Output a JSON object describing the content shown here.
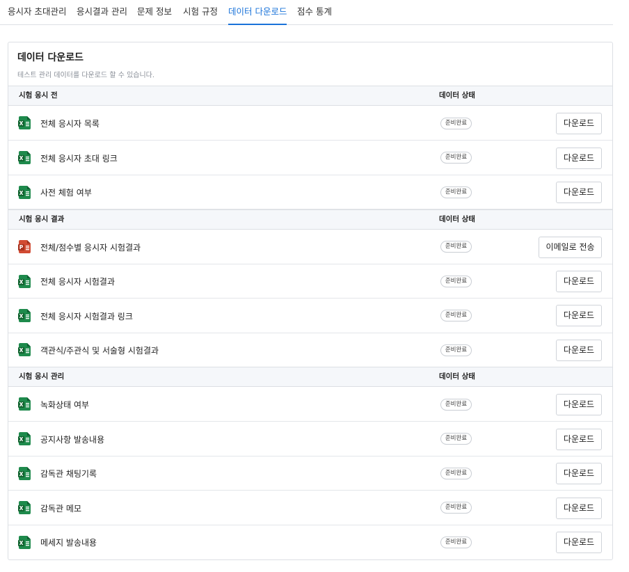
{
  "tabs": [
    {
      "label": "응시자 초대관리",
      "active": false
    },
    {
      "label": "응시결과 관리",
      "active": false
    },
    {
      "label": "문제 정보",
      "active": false
    },
    {
      "label": "시험 규정",
      "active": false
    },
    {
      "label": "데이터 다운로드",
      "active": true
    },
    {
      "label": "점수 통계",
      "active": false
    }
  ],
  "panel": {
    "title": "데이터 다운로드",
    "subtitle": "테스트 관리 데이터를 다운로드 할 수 있습니다."
  },
  "sections": [
    {
      "label": "시험 응시 전",
      "status_header": "데이터 상태",
      "rows": [
        {
          "icon": "excel-file-icon",
          "label": "전체 응시자 목록",
          "status": "준비완료",
          "action": "다운로드"
        },
        {
          "icon": "excel-file-icon",
          "label": "전체 응시자 초대 링크",
          "status": "준비완료",
          "action": "다운로드"
        },
        {
          "icon": "excel-file-icon",
          "label": "사전 체험 여부",
          "status": "준비완료",
          "action": "다운로드"
        }
      ]
    },
    {
      "label": "시험 응시 결과",
      "status_header": "데이터 상태",
      "rows": [
        {
          "icon": "powerpoint-file-icon",
          "label": "전체/점수별 응시자 시험결과",
          "status": "준비완료",
          "action": "이메일로 전송"
        },
        {
          "icon": "excel-file-icon",
          "label": "전체 응시자 시험결과",
          "status": "준비완료",
          "action": "다운로드"
        },
        {
          "icon": "excel-file-icon",
          "label": "전체 응시자 시험결과 링크",
          "status": "준비완료",
          "action": "다운로드"
        },
        {
          "icon": "excel-file-icon",
          "label": "객관식/주관식 및 서술형 시험결과",
          "status": "준비완료",
          "action": "다운로드"
        }
      ]
    },
    {
      "label": "시험 응시 관리",
      "status_header": "데이터 상태",
      "rows": [
        {
          "icon": "excel-file-icon",
          "label": "녹화상태 여부",
          "status": "준비완료",
          "action": "다운로드"
        },
        {
          "icon": "excel-file-icon",
          "label": "공지사항 발송내용",
          "status": "준비완료",
          "action": "다운로드"
        },
        {
          "icon": "excel-file-icon",
          "label": "감독관 채팅기록",
          "status": "준비완료",
          "action": "다운로드"
        },
        {
          "icon": "excel-file-icon",
          "label": "감독관 메모",
          "status": "준비완료",
          "action": "다운로드"
        },
        {
          "icon": "excel-file-icon",
          "label": "메세지 발송내용",
          "status": "준비완료",
          "action": "다운로드"
        }
      ]
    }
  ],
  "colors": {
    "accent": "#1a73d9",
    "excel": "#1e8a4c",
    "powerpoint": "#d14b33"
  }
}
